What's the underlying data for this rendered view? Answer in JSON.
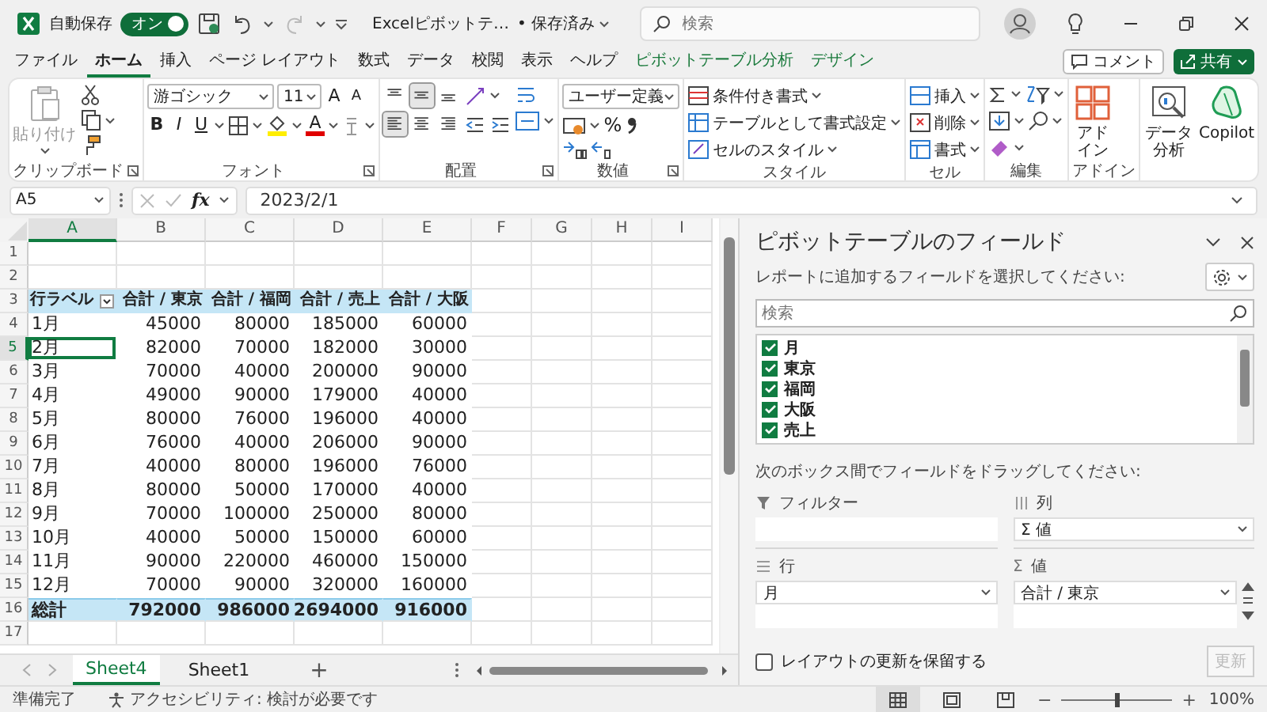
{
  "titlebar": {
    "autosave_label": "自動保存",
    "autosave": {
      "label": "オン",
      "on": true
    },
    "redo": {
      "disabled": true
    },
    "document_title": "Excelピボットテ…",
    "save_status": "• 保存済み",
    "search": {
      "placeholder": "検索"
    }
  },
  "menu": {
    "tabs": [
      {
        "label": "ファイル",
        "selected": false,
        "kind": "standard"
      },
      {
        "label": "ホーム",
        "selected": true,
        "kind": "standard"
      },
      {
        "label": "挿入",
        "selected": false,
        "kind": "standard"
      },
      {
        "label": "ページ レイアウト",
        "selected": false,
        "kind": "standard"
      },
      {
        "label": "数式",
        "selected": false,
        "kind": "standard"
      },
      {
        "label": "データ",
        "selected": false,
        "kind": "standard"
      },
      {
        "label": "校閲",
        "selected": false,
        "kind": "standard"
      },
      {
        "label": "表示",
        "selected": false,
        "kind": "standard"
      },
      {
        "label": "ヘルプ",
        "selected": false,
        "kind": "standard"
      },
      {
        "label": "ピボットテーブル分析",
        "selected": false,
        "kind": "contextual"
      },
      {
        "label": "デザイン",
        "selected": false,
        "kind": "contextual"
      }
    ],
    "comment_button": "コメント",
    "share_button": "共有"
  },
  "ribbon": {
    "groups": [
      {
        "kind": "clipboard",
        "label": "クリップボード",
        "paste": {
          "label": "貼り付け",
          "disabled": true
        }
      },
      {
        "kind": "font",
        "label": "フォント",
        "font_name": "游ゴシック",
        "font_size": "11",
        "grow": "A",
        "shrink": "A",
        "bold": "B",
        "italic": "I",
        "underline": "U",
        "font_color": "A"
      },
      {
        "kind": "alignment",
        "label": "配置",
        "buttons": [
          {
            "kind": "top",
            "selected": false
          },
          {
            "kind": "middle",
            "selected": true
          },
          {
            "kind": "bottom",
            "selected": false
          },
          {
            "kind": "left",
            "selected": true
          },
          {
            "kind": "center",
            "selected": false
          },
          {
            "kind": "right",
            "selected": false
          }
        ]
      },
      {
        "kind": "number",
        "label": "数値",
        "format": "ユーザー定義",
        "percent": "%"
      },
      {
        "kind": "styles",
        "label": "スタイル",
        "buttons": [
          "条件付き書式",
          "テーブルとして書式設定",
          "セルのスタイル"
        ]
      },
      {
        "kind": "cells",
        "label": "セル",
        "buttons": [
          "挿入",
          "削除",
          "書式"
        ]
      },
      {
        "kind": "editing",
        "label": "編集"
      },
      {
        "kind": "addins",
        "label": "アドイン",
        "buttons": [
          "アドイン"
        ]
      },
      {
        "kind": "tools",
        "buttons": [
          "データ分析",
          "Copilot"
        ]
      }
    ]
  },
  "formula_bar": {
    "name_box": "A5",
    "fx": "fx",
    "value": "2023/2/1"
  },
  "sheet": {
    "columns": [
      {
        "label": "A",
        "selected": true
      },
      {
        "label": "B",
        "selected": false
      },
      {
        "label": "C",
        "selected": false
      },
      {
        "label": "D",
        "selected": false
      },
      {
        "label": "E",
        "selected": false
      },
      {
        "label": "F",
        "selected": false
      },
      {
        "label": "G",
        "selected": false
      },
      {
        "label": "H",
        "selected": false
      },
      {
        "label": "I",
        "selected": false
      }
    ],
    "rows": [
      {
        "label": "1",
        "selected": false,
        "kind": "blank"
      },
      {
        "label": "2",
        "selected": false,
        "kind": "blank"
      },
      {
        "label": "3",
        "selected": false,
        "kind": "header",
        "cells": [
          "行ラベル",
          "合計 / 東京",
          "合計 / 福岡",
          "合計 / 売上",
          "合計 / 大阪"
        ]
      },
      {
        "label": "4",
        "selected": false,
        "kind": "data",
        "cells": [
          "1月",
          "45000",
          "80000",
          "185000",
          "60000"
        ]
      },
      {
        "label": "5",
        "selected": true,
        "kind": "data",
        "cells": [
          "2月",
          "82000",
          "70000",
          "182000",
          "30000"
        ]
      },
      {
        "label": "6",
        "selected": false,
        "kind": "data",
        "cells": [
          "3月",
          "70000",
          "40000",
          "200000",
          "90000"
        ]
      },
      {
        "label": "7",
        "selected": false,
        "kind": "data",
        "cells": [
          "4月",
          "49000",
          "90000",
          "179000",
          "40000"
        ]
      },
      {
        "label": "8",
        "selected": false,
        "kind": "data",
        "cells": [
          "5月",
          "80000",
          "76000",
          "196000",
          "40000"
        ]
      },
      {
        "label": "9",
        "selected": false,
        "kind": "data",
        "cells": [
          "6月",
          "76000",
          "40000",
          "206000",
          "90000"
        ]
      },
      {
        "label": "10",
        "selected": false,
        "kind": "data",
        "cells": [
          "7月",
          "40000",
          "80000",
          "196000",
          "76000"
        ]
      },
      {
        "label": "11",
        "selected": false,
        "kind": "data",
        "cells": [
          "8月",
          "80000",
          "50000",
          "170000",
          "40000"
        ]
      },
      {
        "label": "12",
        "selected": false,
        "kind": "data",
        "cells": [
          "9月",
          "70000",
          "100000",
          "250000",
          "80000"
        ]
      },
      {
        "label": "13",
        "selected": false,
        "kind": "data",
        "cells": [
          "10月",
          "40000",
          "50000",
          "150000",
          "60000"
        ]
      },
      {
        "label": "14",
        "selected": false,
        "kind": "data",
        "cells": [
          "11月",
          "90000",
          "220000",
          "460000",
          "150000"
        ]
      },
      {
        "label": "15",
        "selected": false,
        "kind": "data",
        "cells": [
          "12月",
          "70000",
          "90000",
          "320000",
          "160000"
        ]
      },
      {
        "label": "16",
        "selected": false,
        "kind": "total",
        "cells": [
          "総計",
          "792000",
          "986000",
          "2694000",
          "916000"
        ]
      },
      {
        "label": "17",
        "selected": false,
        "kind": "blank"
      }
    ],
    "tabs": [
      {
        "label": "Sheet4",
        "selected": true
      },
      {
        "label": "Sheet1",
        "selected": false
      }
    ],
    "add_sheet": "+"
  },
  "pivot_pane": {
    "title": "ピボットテーブルのフィールド",
    "instruction": "レポートに追加するフィールドを選択してください:",
    "search": {
      "placeholder": "検索"
    },
    "fields": [
      {
        "label": "月",
        "checked": true
      },
      {
        "label": "東京",
        "checked": true
      },
      {
        "label": "福岡",
        "checked": true
      },
      {
        "label": "大阪",
        "checked": true
      },
      {
        "label": "売上",
        "checked": true
      }
    ],
    "drag_instruction": "次のボックス間でフィールドをドラッグしてください:",
    "areas": [
      {
        "kind": "filter",
        "title": "フィルター"
      },
      {
        "kind": "columns",
        "title": "列",
        "items": [
          "Σ 値"
        ]
      },
      {
        "kind": "rows",
        "title": "行",
        "items": [
          "月"
        ]
      },
      {
        "kind": "values",
        "symbol": "Σ",
        "title": "値",
        "items": [
          "合計 / 東京"
        ]
      }
    ],
    "defer": {
      "label": "レイアウトの更新を保留する",
      "checked": false
    },
    "update_button": {
      "label": "更新",
      "disabled": true
    }
  },
  "status_bar": {
    "ready": "準備完了",
    "accessibility": "アクセシビリティ: 検討が必要です",
    "views": [
      {
        "kind": "normal",
        "selected": true
      },
      {
        "kind": "page_layout",
        "selected": false
      },
      {
        "kind": "page_break",
        "selected": false
      }
    ],
    "zoom_out": "−",
    "zoom": {
      "level": 0.5
    },
    "zoom_in": "+",
    "zoom_reading": "100%"
  }
}
